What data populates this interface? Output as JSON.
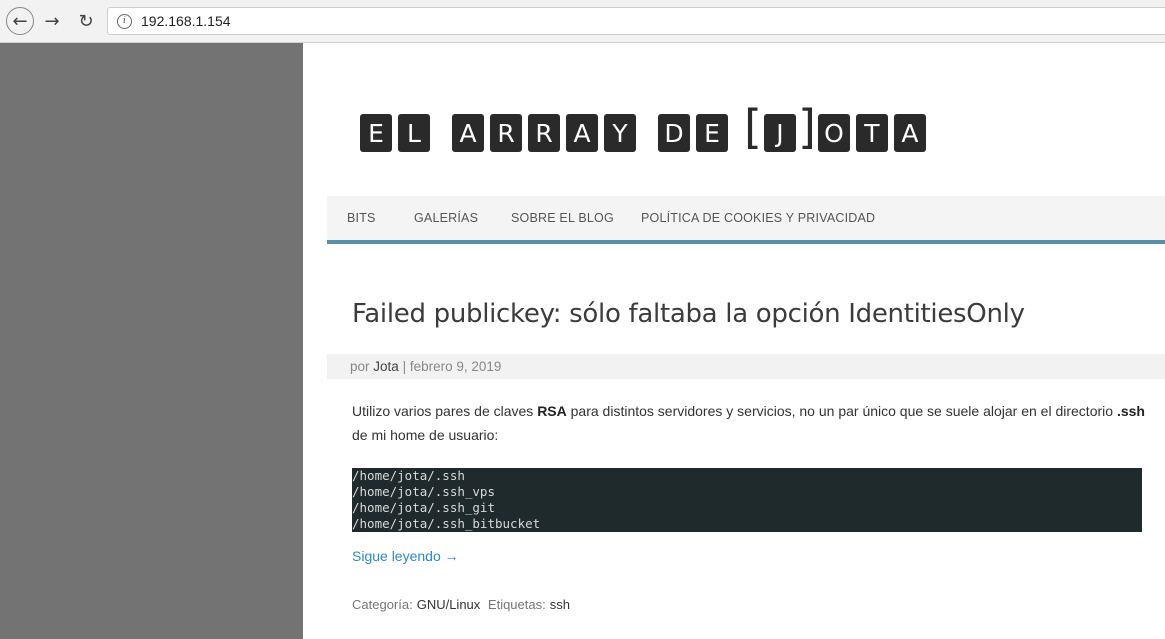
{
  "browser": {
    "url": "192.168.1.154",
    "back_icon": "arrow-left-icon",
    "forward_icon": "arrow-right-icon",
    "reload_icon": "reload-icon"
  },
  "site": {
    "logo_words": [
      [
        "E",
        "L"
      ],
      [
        "A",
        "R",
        "R",
        "A",
        "Y"
      ],
      [
        "D",
        "E"
      ]
    ],
    "logo_bracket_open": "[",
    "logo_bracket_letter": "J",
    "logo_bracket_close": "]",
    "logo_tail": [
      "O",
      "T",
      "A"
    ]
  },
  "menu": {
    "items": [
      "BITS",
      "GALERÍAS",
      "SOBRE EL BLOG",
      "POLÍTICA DE COOKIES Y PRIVACIDAD"
    ]
  },
  "post": {
    "title": "Failed publickey: sólo faltaba la opción IdentitiesOnly",
    "meta_by": "por",
    "meta_author": "Jota",
    "meta_sep": "|",
    "meta_date": "febrero 9, 2019",
    "para_part1": "Utilizo varios pares de claves ",
    "para_bold1": "RSA",
    "para_part2": " para distintos servidores y servicios, no un par único que se suele alojar en el directorio ",
    "para_bold2": ".ssh",
    "para_part3": " de mi home de usuario:",
    "code_lines": [
      "/home/jota/.ssh",
      "/home/jota/.ssh_vps",
      "/home/jota/.ssh_git",
      "/home/jota/.ssh_bitbucket"
    ],
    "read_more": "Sigue leyendo →",
    "category_label": "Categoría:",
    "category_value": "GNU/Linux",
    "tags_label": "Etiquetas:",
    "tags_value": "ssh"
  },
  "colors": {
    "menu_accent": "#5b8ea7",
    "link": "#2b8bc7",
    "code_bg": "#1f2a2c",
    "side_gray": "#737373"
  }
}
